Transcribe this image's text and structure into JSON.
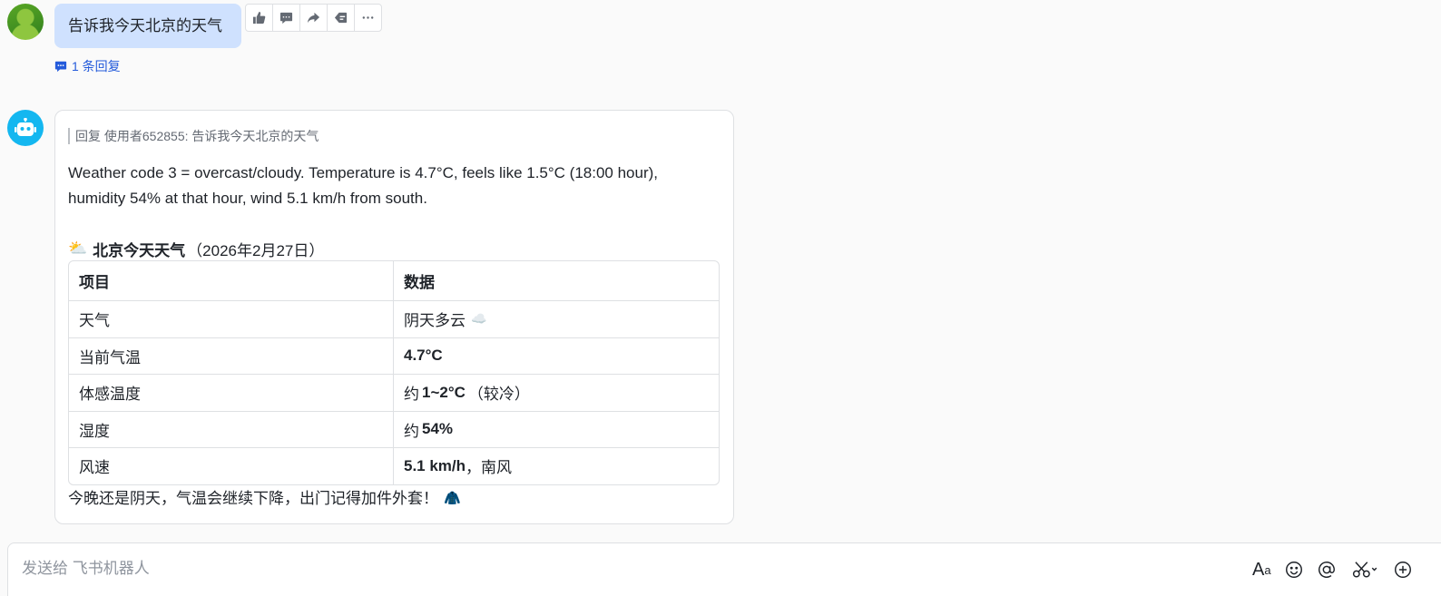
{
  "user_message": {
    "text": "告诉我今天北京的天气",
    "reply_count_label": "1 条回复"
  },
  "toolbar": {
    "icons": [
      "thumbs-up-icon",
      "comment-icon",
      "forward-icon",
      "reply-icon",
      "more-icon"
    ]
  },
  "bot_message": {
    "quote": "回复 使用者652855:  告诉我今天北京的天气",
    "answer": "Weather code 3 = overcast/cloudy. Temperature is 4.7°C, feels like 1.5°C (18:00 hour), humidity 54% at that hour, wind 5.1 km/h from south.",
    "heading_emoji": "⛅",
    "heading_title": "北京今天天气",
    "heading_date": "（2026年2月27日）",
    "table": {
      "headers": [
        "项目",
        "数据"
      ],
      "rows": [
        {
          "label": "天气",
          "pre": "阴天多云",
          "bold": "",
          "post": "☁️"
        },
        {
          "label": "当前气温",
          "pre": "",
          "bold": "4.7°C",
          "post": ""
        },
        {
          "label": "体感温度",
          "pre": "约",
          "bold": "1~2°C",
          "post": "（较冷）"
        },
        {
          "label": "湿度",
          "pre": "约",
          "bold": "54%",
          "post": ""
        },
        {
          "label": "风速",
          "pre": "",
          "bold": "5.1 km/h",
          "post": "，南风"
        }
      ]
    },
    "footer": "今晚还是阴天，气温会继续下降，出门记得加件外套！",
    "footer_emoji": "🧥"
  },
  "composer": {
    "placeholder": "发送给 飞书机器人",
    "icons": [
      "text-format-icon",
      "emoji-icon",
      "mention-icon",
      "screenshot-icon",
      "add-icon"
    ]
  },
  "colors": {
    "user_bubble": "#cfe1fe",
    "link": "#245bdb",
    "bot_avatar": "#14b7f0"
  }
}
